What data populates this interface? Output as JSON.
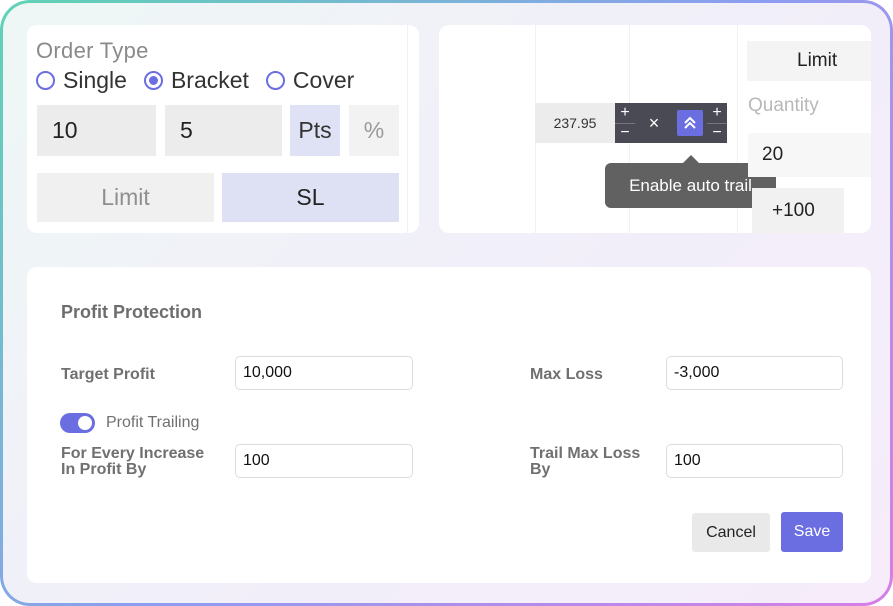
{
  "order_type": {
    "title": "Order Type",
    "options": [
      {
        "label": "Single",
        "selected": false
      },
      {
        "label": "Bracket",
        "selected": true
      },
      {
        "label": "Cover",
        "selected": false
      }
    ],
    "target_value": "10",
    "stoploss_value": "5",
    "unit_pts": "Pts",
    "unit_pct": "%",
    "limit_label": "Limit",
    "sl_label": "SL"
  },
  "order_panel": {
    "price": "237.95",
    "plus": "+",
    "minus": "−",
    "close": "×",
    "trail_icon": "double-chevron-up-icon",
    "tooltip": "Enable auto trail",
    "limit_label": "Limit",
    "quantity_label": "Quantity",
    "quantity_value": "20",
    "increment_label": "+100"
  },
  "profit_protection": {
    "title": "Profit Protection",
    "target_profit_label": "Target Profit",
    "target_profit_value": "10,000",
    "max_loss_label": "Max Loss",
    "max_loss_value": "-3,000",
    "trailing_label": "Profit Trailing",
    "trailing_on": true,
    "increase_label_1": "For Every Increase",
    "increase_label_2": "In Profit By",
    "increase_value": "100",
    "trail_label_1": "Trail Max Loss",
    "trail_label_2": "By",
    "trail_value": "100",
    "cancel_label": "Cancel",
    "save_label": "Save"
  },
  "colors": {
    "accent": "#6a6ee0",
    "dark_toolbar": "#4a4a55",
    "tooltip_bg": "#616161"
  }
}
